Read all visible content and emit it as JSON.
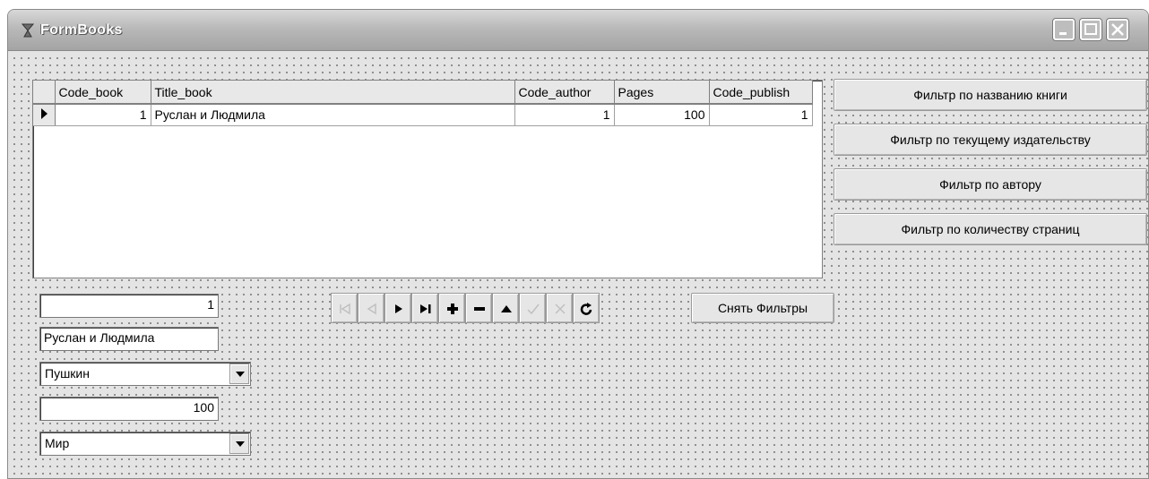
{
  "window": {
    "title": "FormBooks"
  },
  "grid": {
    "columns": [
      "Code_book",
      "Title_book",
      "Code_author",
      "Pages",
      "Code_publish"
    ],
    "rows": [
      {
        "code_book": "1",
        "title_book": "Руслан и Людмила",
        "code_author": "1",
        "pages": "100",
        "code_publish": "1"
      }
    ]
  },
  "filters": {
    "by_title": "Фильтр по названию книги",
    "by_publisher": "Фильтр по текущему издательству",
    "by_author": "Фильтр по автору",
    "by_pages": "Фильтр по количеству страниц",
    "clear": "Снять Фильтры"
  },
  "fields": {
    "code_book": "1",
    "title_book": "Руслан и Людмила",
    "author": "Пушкин",
    "pages": "100",
    "publisher": "Мир"
  },
  "navigator": {
    "buttons": [
      "first-icon",
      "prior-icon",
      "next-icon",
      "last-icon",
      "insert-icon",
      "delete-icon",
      "edit-icon",
      "post-icon",
      "cancel-icon",
      "refresh-icon"
    ],
    "enabled": [
      false,
      false,
      true,
      true,
      true,
      true,
      true,
      false,
      false,
      true
    ]
  },
  "colors": {
    "form": "#e4e4e4",
    "titlebar": "#b9b9b9",
    "disabled_icon": "#c0c0c0"
  }
}
